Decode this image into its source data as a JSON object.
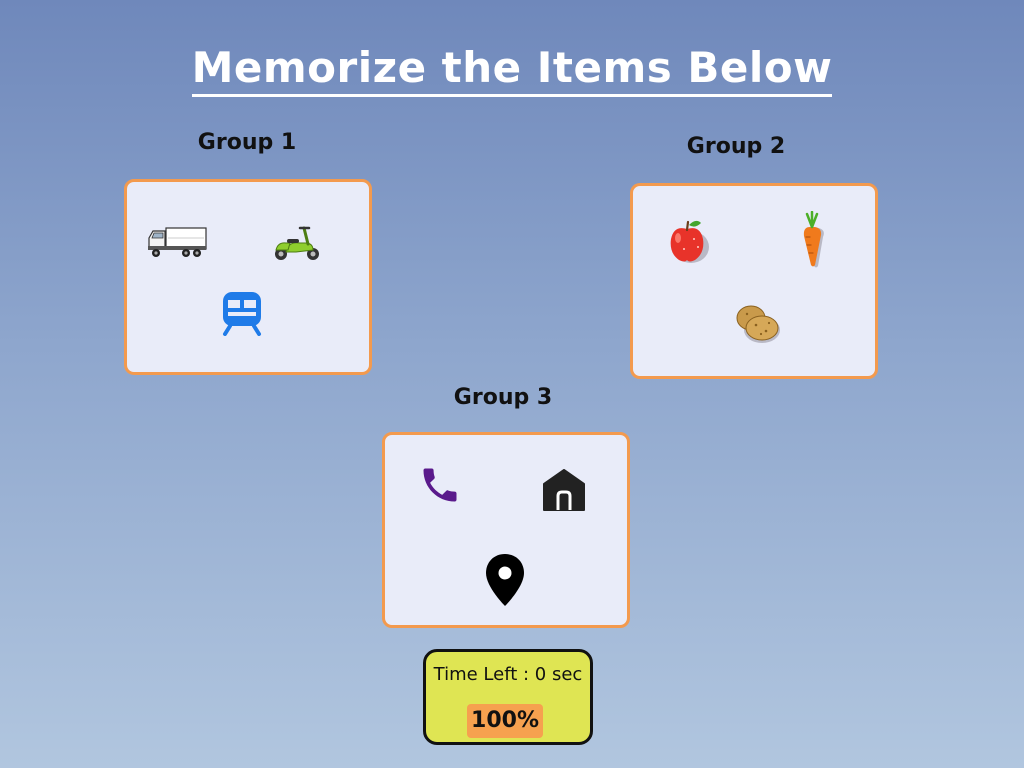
{
  "title": "Memorize the Items Below",
  "groups": [
    {
      "label": "Group 1",
      "items": [
        {
          "icon": "truck-icon"
        },
        {
          "icon": "scooter-icon"
        },
        {
          "icon": "train-icon"
        }
      ]
    },
    {
      "label": "Group 2",
      "items": [
        {
          "icon": "apple-icon"
        },
        {
          "icon": "carrot-icon"
        },
        {
          "icon": "potato-icon"
        }
      ]
    },
    {
      "label": "Group 3",
      "items": [
        {
          "icon": "phone-icon"
        },
        {
          "icon": "home-icon"
        },
        {
          "icon": "location-pin-icon"
        }
      ]
    }
  ],
  "timer": {
    "text": "Time Left : 0 sec",
    "percent": "100%"
  },
  "colors": {
    "card_border": "#f39a4e",
    "card_background": "#e9ecf9",
    "timer_background": "#dfe553",
    "percent_badge": "#f6a14f"
  }
}
